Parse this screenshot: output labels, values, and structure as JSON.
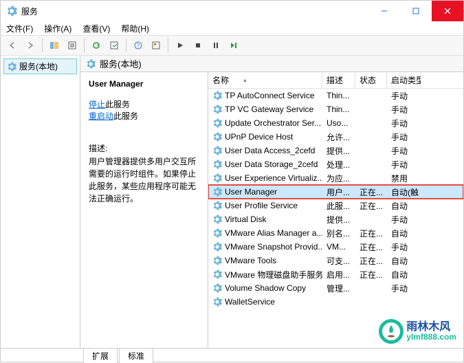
{
  "titlebar": {
    "title": "服务"
  },
  "menu": {
    "file": "文件(F)",
    "action": "操作(A)",
    "view": "查看(V)",
    "help": "帮助(H)"
  },
  "leftpane": {
    "label": "服务(本地)"
  },
  "rightheader": {
    "label": "服务(本地)"
  },
  "detail": {
    "title": "User Manager",
    "stopLink": "停止",
    "stopSuffix": "此服务",
    "restartLink": "重启动",
    "restartSuffix": "此服务",
    "descLabel": "描述:",
    "descText": "用户管理器提供多用户交互所需要的运行时组件。如果停止此服务，某些应用程序可能无法正确运行。"
  },
  "columns": {
    "name": "名称",
    "desc": "描述",
    "status": "状态",
    "start": "启动类型"
  },
  "rows": [
    {
      "name": "TP AutoConnect Service",
      "desc": "Thin...",
      "status": "",
      "start": "手动",
      "hl": false
    },
    {
      "name": "TP VC Gateway Service",
      "desc": "Thin...",
      "status": "",
      "start": "手动",
      "hl": false
    },
    {
      "name": "Update Orchestrator Ser...",
      "desc": "Uso...",
      "status": "",
      "start": "手动",
      "hl": false
    },
    {
      "name": "UPnP Device Host",
      "desc": "允许...",
      "status": "",
      "start": "手动",
      "hl": false
    },
    {
      "name": "User Data Access_2cefd",
      "desc": "提供...",
      "status": "",
      "start": "手动",
      "hl": false
    },
    {
      "name": "User Data Storage_2cefd",
      "desc": "处理...",
      "status": "",
      "start": "手动",
      "hl": false
    },
    {
      "name": "User Experience Virtualiz...",
      "desc": "为应...",
      "status": "",
      "start": "禁用",
      "hl": false
    },
    {
      "name": "User Manager",
      "desc": "用户...",
      "status": "正在...",
      "start": "自动(触",
      "hl": true
    },
    {
      "name": "User Profile Service",
      "desc": "此服...",
      "status": "正在...",
      "start": "自动",
      "hl": false
    },
    {
      "name": "Virtual Disk",
      "desc": "提供...",
      "status": "",
      "start": "手动",
      "hl": false
    },
    {
      "name": "VMware Alias Manager a...",
      "desc": "别名...",
      "status": "正在...",
      "start": "自动",
      "hl": false
    },
    {
      "name": "VMware Snapshot Provid...",
      "desc": "VM...",
      "status": "正在...",
      "start": "手动",
      "hl": false
    },
    {
      "name": "VMware Tools",
      "desc": "可支...",
      "status": "正在...",
      "start": "自动",
      "hl": false
    },
    {
      "name": "VMware 物理磁盘助手服务",
      "desc": "启用...",
      "status": "正在...",
      "start": "自动",
      "hl": false
    },
    {
      "name": "Volume Shadow Copy",
      "desc": "管理...",
      "status": "",
      "start": "手动",
      "hl": false
    },
    {
      "name": "WalletService",
      "desc": "",
      "status": "",
      "start": "",
      "hl": false
    }
  ],
  "tabs": {
    "extended": "扩展",
    "standard": "标准"
  },
  "watermark": {
    "cn": "雨林木风",
    "url": "ylmf888.com"
  }
}
